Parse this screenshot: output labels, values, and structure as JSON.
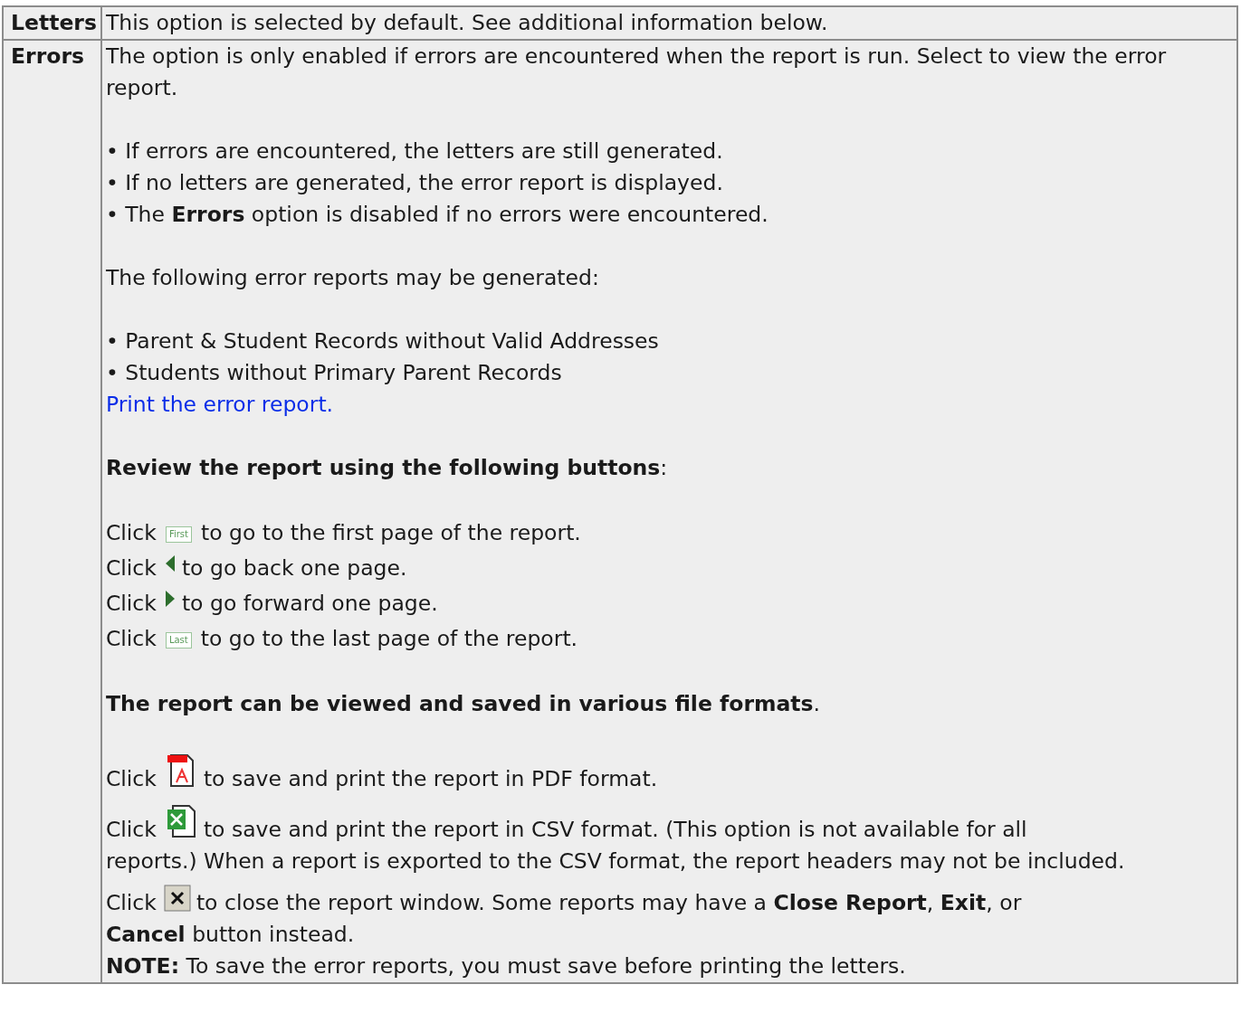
{
  "rows": [
    {
      "label": "Letters",
      "groups": [
        [
          {
            "kind": "text",
            "text": "This option is selected by default. See additional information below."
          }
        ]
      ]
    },
    {
      "label": "Errors",
      "groups": [
        [
          {
            "kind": "text",
            "text": "The option is only enabled if errors are encountered when the report is run. Select to view the error report."
          }
        ],
        [
          {
            "kind": "text",
            "text": "• If errors are encountered, the letters are still generated."
          },
          {
            "kind": "text",
            "text": "• If no letters are generated, the error report is displayed."
          },
          {
            "kind": "text",
            "text": "• The **Errors** option is disabled if no errors were encountered."
          }
        ],
        [
          {
            "kind": "text",
            "text": "The following error reports may be generated:"
          }
        ],
        [
          {
            "kind": "text",
            "text": "• Parent & Student Records without Valid Addresses"
          },
          {
            "kind": "text",
            "text": "• Students without Primary Parent Records"
          },
          {
            "kind": "link",
            "text": "Print the error report."
          }
        ],
        [
          {
            "kind": "text",
            "text": "**Review the report using the following buttons**:"
          }
        ],
        [
          {
            "kind": "first",
            "prefix": "Click",
            "icon_label": "First",
            "text": "to go to the first page of the report."
          },
          {
            "kind": "back",
            "prefix": "Click",
            "text": "to go back one page."
          },
          {
            "kind": "forward",
            "prefix": "Click",
            "text": "to go forward one page."
          },
          {
            "kind": "last",
            "prefix": "Click",
            "icon_label": "Last",
            "text": "to go to the last page of the report."
          }
        ],
        [
          {
            "kind": "text",
            "text": "**The report can be viewed and saved in various file formats**."
          }
        ],
        [
          {
            "kind": "pdf",
            "prefix": "Click",
            "text": "to save and print the report in PDF format."
          },
          {
            "kind": "csv",
            "prefix": "Click",
            "text": "to save and print the report in CSV format. (This option is not available for all",
            "continuation": "reports.) When a report is exported to the CSV format, the report headers may not be included."
          },
          {
            "kind": "close",
            "prefix": "Click",
            "text": "to close the report window. Some reports may have a **Close Report**, **Exit**, or",
            "continuation": "**Cancel** button instead."
          },
          {
            "kind": "text",
            "text": "**NOTE:** To save the error reports, you must save before printing the letters."
          }
        ]
      ]
    }
  ]
}
